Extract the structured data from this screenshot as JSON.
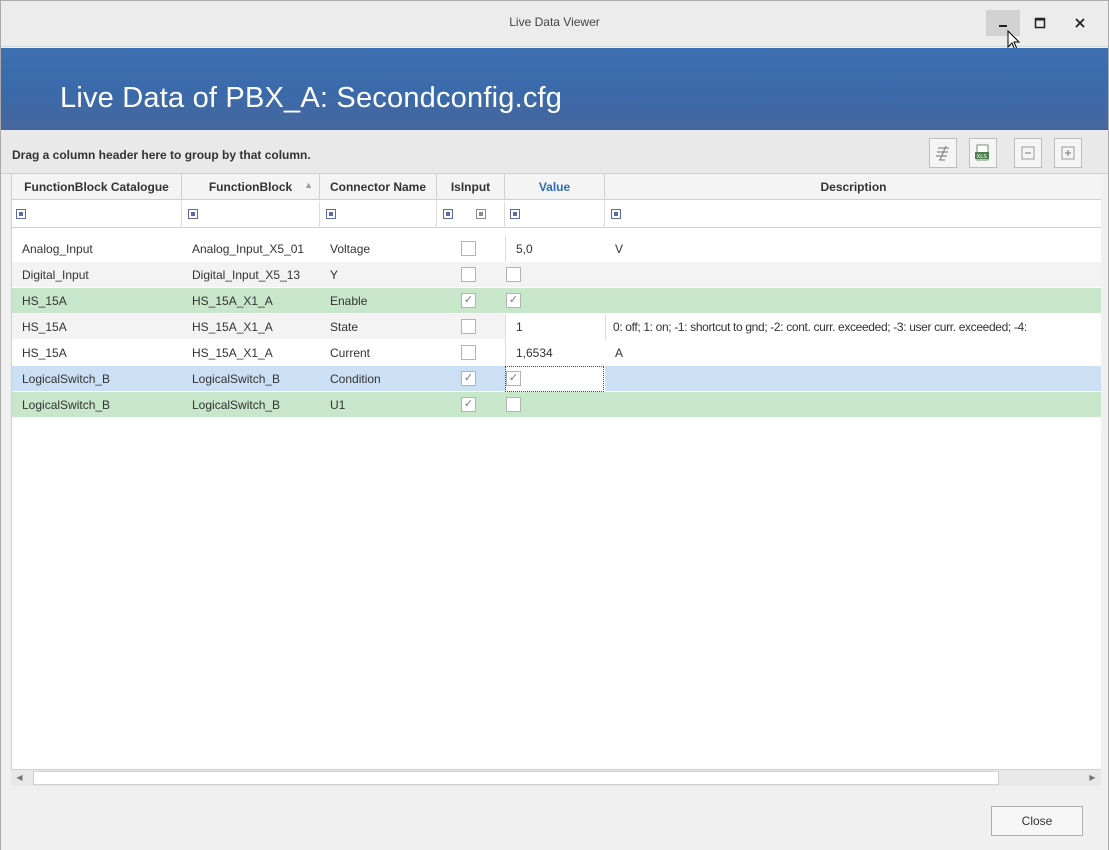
{
  "window": {
    "title": "Live Data Viewer"
  },
  "banner": {
    "heading": "Live Data of PBX_A: Secondconfig.cfg"
  },
  "groupbar": {
    "hint": "Drag a column header here to group by that column."
  },
  "toolbar": {
    "icons": [
      "column-chooser-icon",
      "export-xls-icon",
      "collapse-all-icon",
      "expand-all-icon"
    ]
  },
  "columns": [
    {
      "label": "FunctionBlock Catalogue"
    },
    {
      "label": "FunctionBlock"
    },
    {
      "label": "Connector Name"
    },
    {
      "label": "IsInput"
    },
    {
      "label": "Value"
    },
    {
      "label": "Description"
    }
  ],
  "rows": [
    {
      "catalogue": "Analog_Input",
      "block": "Analog_Input_X5_01",
      "connector": "Voltage",
      "is_input": false,
      "value": "5,0",
      "description": "V",
      "style": "white"
    },
    {
      "catalogue": "Digital_Input",
      "block": "Digital_Input_X5_13",
      "connector": "Y",
      "is_input": false,
      "value_check": false,
      "description": "",
      "style": "gray"
    },
    {
      "catalogue": "HS_15A",
      "block": "HS_15A_X1_A",
      "connector": "Enable",
      "is_input": true,
      "value_check": true,
      "description": "",
      "style": "green"
    },
    {
      "catalogue": "HS_15A",
      "block": "HS_15A_X1_A",
      "connector": "State",
      "is_input": false,
      "value": "1",
      "description": "0: off; 1: on; -1: shortcut to gnd; -2: cont. curr. exceeded; -3: user curr. exceeded; -4:",
      "style": "gray"
    },
    {
      "catalogue": "HS_15A",
      "block": "HS_15A_X1_A",
      "connector": "Current",
      "is_input": false,
      "value": "1,6534",
      "description": "A",
      "style": "white"
    },
    {
      "catalogue": "LogicalSwitch_B",
      "block": "LogicalSwitch_B",
      "connector": "Condition",
      "is_input": true,
      "value_check": true,
      "description": "",
      "style": "blue"
    },
    {
      "catalogue": "LogicalSwitch_B",
      "block": "LogicalSwitch_B",
      "connector": "U1",
      "is_input": true,
      "value_check": false,
      "description": "",
      "style": "green"
    }
  ],
  "footer": {
    "close_label": "Close"
  },
  "colors": {
    "banner": "#3c6fb1",
    "row_green": "#c8e6c9",
    "row_selected": "#cce0f5",
    "value_header": "#2a6db8"
  }
}
